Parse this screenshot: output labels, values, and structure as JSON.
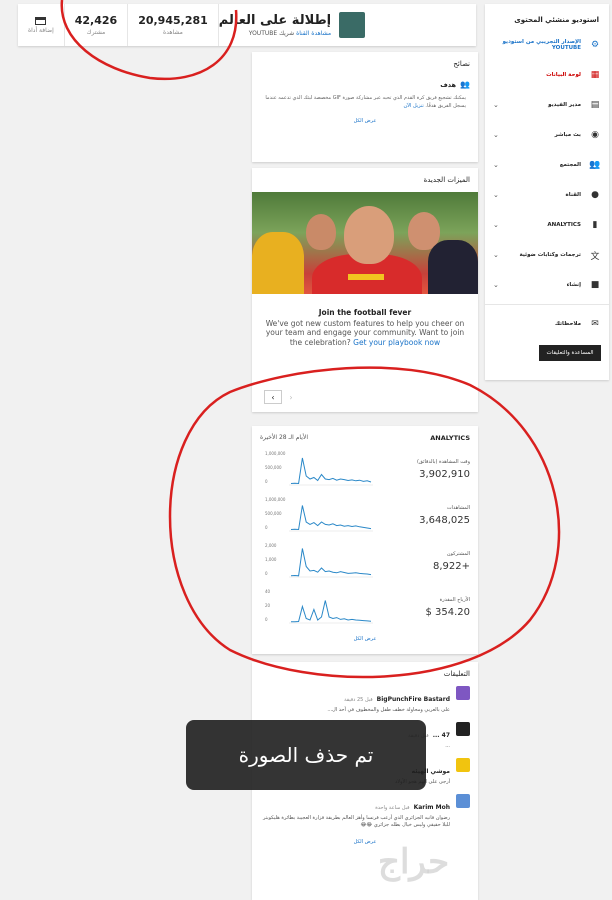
{
  "topbar": {
    "channel_name": "إطلالة على العالم",
    "channel_link": "مشاهدة القناة",
    "channel_partner": "شريك YOUTUBE",
    "stats": [
      {
        "value": "20,945,281",
        "label": "مشاهدة"
      },
      {
        "value": "42,426",
        "label": "مشترك"
      },
      {
        "icon": "video-add-icon",
        "label": "إضافة أداة"
      }
    ]
  },
  "sidebar": {
    "title": "استوديو منشئي المحتوى",
    "items": [
      {
        "label": "الإصدار التجريبي من استوديو YOUTUBE",
        "icon": "gear-icon"
      },
      {
        "label": "لوحة البيانات",
        "icon": "dashboard-icon"
      },
      {
        "label": "مدير الفيديو",
        "icon": "video-manager-icon"
      },
      {
        "label": "بث مباشر",
        "icon": "broadcast-icon"
      },
      {
        "label": "المجتمع",
        "icon": "community-icon"
      },
      {
        "label": "القناة",
        "icon": "channel-icon"
      },
      {
        "label": "ANALYTICS",
        "icon": "analytics-icon"
      },
      {
        "label": "ترجمات وكتابات ضوئية",
        "icon": "translate-icon"
      },
      {
        "label": "إنشاء",
        "icon": "create-icon"
      },
      {
        "label": "ملاحظاتك",
        "icon": "feedback-icon"
      }
    ],
    "help_button": "المساعدة والتعليقات"
  },
  "tips": {
    "title": "نصائح",
    "goal_title": "هدف",
    "goal_text": "يمكنك تشجيع فريق كرة القدم الذي تحبه عبر مشاركة صورة GIF مخصصة لبثك الذي تدعمه عندما يسجل الفريق هدفًا.",
    "goal_link": "تنزيل الآن",
    "view_all": "عرض الكل"
  },
  "features": {
    "title": "الميزات الجديدة",
    "headline": "Join the football fever",
    "desc": "We've got new custom features to help you cheer on your team and engage your community. Want to join the celebration?",
    "link": "Get your playbook now"
  },
  "analytics": {
    "title": "ANALYTICS",
    "period": "الأيام الـ 28 الأخيرة",
    "view_all": "عرض الكل",
    "metrics": [
      {
        "label": "وقت المشاهدة (بالدقائق)",
        "value": "3,902,910",
        "axis": [
          "1,000,000",
          "500,000",
          "0"
        ]
      },
      {
        "label": "المشاهدات",
        "value": "3,648,025",
        "axis": [
          "1,000,000",
          "500,000",
          "0"
        ]
      },
      {
        "label": "المشتركون",
        "value": "+8,922",
        "axis": [
          "2,000",
          "1,000",
          "0"
        ]
      },
      {
        "label": "الأرباح المقدرة",
        "value": "354.20 $",
        "axis": [
          "40",
          "20",
          "0"
        ]
      }
    ]
  },
  "comments": {
    "title": "التعليقات",
    "items": [
      {
        "name": "BigPunchFire Bastard",
        "time": "قبل 25 دقيقة",
        "text": "على بالعربي ومحاولة خطف طفل والمخطوف في أحد ال...",
        "color": "#7e57c2"
      },
      {
        "name": "47 ...",
        "time": "قبل دقيقة",
        "text": "...",
        "color": "#222222"
      },
      {
        "name": "موشي الهيئه",
        "time": "",
        "text": "أرجى على الهم هجو الأولاد",
        "color": "#f1c40f"
      },
      {
        "name": "Karim Moh",
        "time": "قبل ساعة واحدة",
        "text": "رضوان فانيه الجزائري الذي أرعب فرنسا وأهز العالم بطريقة فزارة العجيبة بطائرة هليكوبتر للبلا حقيقي وليس خيال بطله جزائري 😂😂",
        "color": "#5b8fd6"
      }
    ],
    "view_all": "عرض الكل"
  },
  "overlay": {
    "toast": "تم حذف الصورة",
    "watermark": "حراج"
  }
}
